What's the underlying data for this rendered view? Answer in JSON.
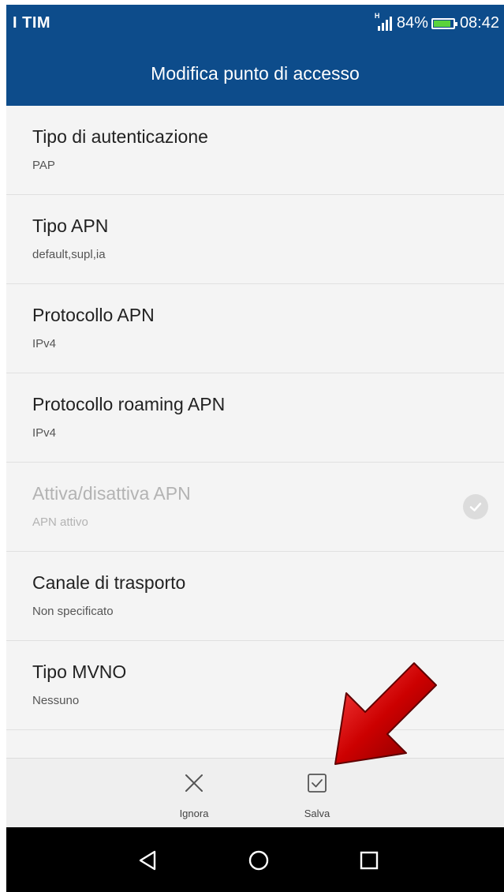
{
  "status_bar": {
    "carrier": "I TIM",
    "network_type": "H",
    "battery": "84%",
    "time": "08:42"
  },
  "header": {
    "title": "Modifica punto di accesso"
  },
  "settings": [
    {
      "title": "Tipo di autenticazione",
      "value": "PAP"
    },
    {
      "title": "Tipo APN",
      "value": "default,supl,ia"
    },
    {
      "title": "Protocollo APN",
      "value": "IPv4"
    },
    {
      "title": "Protocollo roaming APN",
      "value": "IPv4"
    },
    {
      "title": "Attiva/disattiva APN",
      "value": "APN attivo",
      "checked": true,
      "disabled": true
    },
    {
      "title": "Canale di trasporto",
      "value": "Non specificato"
    },
    {
      "title": "Tipo MVNO",
      "value": "Nessuno"
    }
  ],
  "actions": {
    "ignora_label": "Ignora",
    "salva_label": "Salva"
  },
  "icons": {
    "ignora": "close-icon",
    "salva": "checkbox-checked-icon",
    "nav_back": "back-triangle-icon",
    "nav_home": "home-circle-icon",
    "nav_recent": "recent-square-icon"
  },
  "colors": {
    "header": "#0d4c8b",
    "battery_fill": "#5ad33c",
    "arrow": "#cc0000",
    "disabled_text": "#b3b3b3"
  }
}
